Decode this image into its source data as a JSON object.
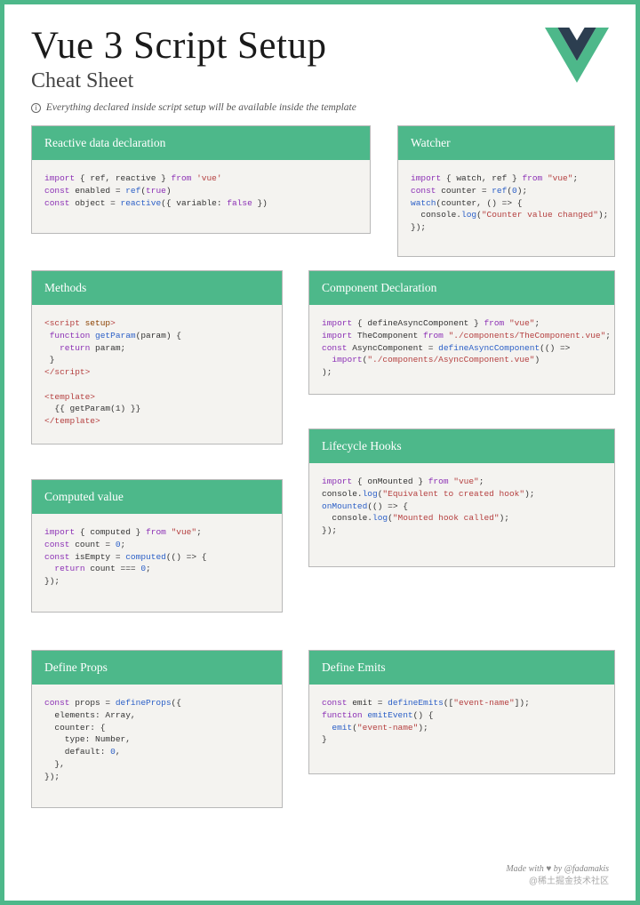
{
  "header": {
    "title": "Vue 3 Script Setup",
    "subtitle": "Cheat Sheet"
  },
  "note": {
    "icon": "i",
    "text": "Everything declared inside script setup will be available inside the template"
  },
  "cards": {
    "reactive": {
      "title": "Reactive data declaration",
      "code": [
        {
          "t": "kw",
          "v": "import"
        },
        {
          "t": "",
          "v": " { ref, reactive } "
        },
        {
          "t": "kw",
          "v": "from"
        },
        {
          "t": "",
          "v": " "
        },
        {
          "t": "str",
          "v": "'vue'"
        },
        {
          "t": "br"
        },
        {
          "t": "kw",
          "v": "const"
        },
        {
          "t": "",
          "v": " enabled = "
        },
        {
          "t": "fn",
          "v": "ref"
        },
        {
          "t": "",
          "v": "("
        },
        {
          "t": "bool",
          "v": "true"
        },
        {
          "t": "",
          "v": ")"
        },
        {
          "t": "br"
        },
        {
          "t": "kw",
          "v": "const"
        },
        {
          "t": "",
          "v": " object = "
        },
        {
          "t": "fn",
          "v": "reactive"
        },
        {
          "t": "",
          "v": "({ variable: "
        },
        {
          "t": "bool",
          "v": "false"
        },
        {
          "t": "",
          "v": " })"
        }
      ]
    },
    "watcher": {
      "title": "Watcher",
      "code": [
        {
          "t": "kw",
          "v": "import"
        },
        {
          "t": "",
          "v": " { watch, ref } "
        },
        {
          "t": "kw",
          "v": "from"
        },
        {
          "t": "",
          "v": " "
        },
        {
          "t": "str",
          "v": "\"vue\""
        },
        {
          "t": "",
          "v": ";"
        },
        {
          "t": "br"
        },
        {
          "t": "kw",
          "v": "const"
        },
        {
          "t": "",
          "v": " counter = "
        },
        {
          "t": "fn",
          "v": "ref"
        },
        {
          "t": "",
          "v": "("
        },
        {
          "t": "num",
          "v": "0"
        },
        {
          "t": "",
          "v": ");"
        },
        {
          "t": "br"
        },
        {
          "t": "fn",
          "v": "watch"
        },
        {
          "t": "",
          "v": "(counter, () => {"
        },
        {
          "t": "br"
        },
        {
          "t": "",
          "v": "  console."
        },
        {
          "t": "fn",
          "v": "log"
        },
        {
          "t": "",
          "v": "("
        },
        {
          "t": "str",
          "v": "\"Counter value changed\""
        },
        {
          "t": "",
          "v": ");"
        },
        {
          "t": "br"
        },
        {
          "t": "",
          "v": "});"
        }
      ]
    },
    "methods": {
      "title": "Methods",
      "code": [
        {
          "t": "tag",
          "v": "<script "
        },
        {
          "t": "attr",
          "v": "setup"
        },
        {
          "t": "tag",
          "v": ">"
        },
        {
          "t": "br"
        },
        {
          "t": "",
          "v": " "
        },
        {
          "t": "kw",
          "v": "function"
        },
        {
          "t": "",
          "v": " "
        },
        {
          "t": "fn",
          "v": "getParam"
        },
        {
          "t": "",
          "v": "(param) {"
        },
        {
          "t": "br"
        },
        {
          "t": "",
          "v": "   "
        },
        {
          "t": "kw",
          "v": "return"
        },
        {
          "t": "",
          "v": " param;"
        },
        {
          "t": "br"
        },
        {
          "t": "",
          "v": " }"
        },
        {
          "t": "br"
        },
        {
          "t": "tag",
          "v": "</script>"
        },
        {
          "t": "br"
        },
        {
          "t": "br"
        },
        {
          "t": "tag",
          "v": "<template>"
        },
        {
          "t": "br"
        },
        {
          "t": "",
          "v": "  {{ getParam(1) }}"
        },
        {
          "t": "br"
        },
        {
          "t": "tag",
          "v": "</template>"
        }
      ]
    },
    "component": {
      "title": "Component Declaration",
      "code": [
        {
          "t": "kw",
          "v": "import"
        },
        {
          "t": "",
          "v": " { defineAsyncComponent } "
        },
        {
          "t": "kw",
          "v": "from"
        },
        {
          "t": "",
          "v": " "
        },
        {
          "t": "str",
          "v": "\"vue\""
        },
        {
          "t": "",
          "v": ";"
        },
        {
          "t": "br"
        },
        {
          "t": "kw",
          "v": "import"
        },
        {
          "t": "",
          "v": " TheComponent "
        },
        {
          "t": "kw",
          "v": "from"
        },
        {
          "t": "",
          "v": " "
        },
        {
          "t": "str",
          "v": "\"./components/TheComponent.vue\""
        },
        {
          "t": "",
          "v": ";"
        },
        {
          "t": "br"
        },
        {
          "t": "kw",
          "v": "const"
        },
        {
          "t": "",
          "v": " AsyncComponent = "
        },
        {
          "t": "fn",
          "v": "defineAsyncComponent"
        },
        {
          "t": "",
          "v": "(() =>"
        },
        {
          "t": "br"
        },
        {
          "t": "",
          "v": "  "
        },
        {
          "t": "kw",
          "v": "import"
        },
        {
          "t": "",
          "v": "("
        },
        {
          "t": "str",
          "v": "\"./components/AsyncComponent.vue\""
        },
        {
          "t": "",
          "v": ")"
        },
        {
          "t": "br"
        },
        {
          "t": "",
          "v": ");"
        }
      ]
    },
    "lifecycle": {
      "title": "Lifecycle Hooks",
      "code": [
        {
          "t": "kw",
          "v": "import"
        },
        {
          "t": "",
          "v": " { onMounted } "
        },
        {
          "t": "kw",
          "v": "from"
        },
        {
          "t": "",
          "v": " "
        },
        {
          "t": "str",
          "v": "\"vue\""
        },
        {
          "t": "",
          "v": ";"
        },
        {
          "t": "br"
        },
        {
          "t": "",
          "v": "console."
        },
        {
          "t": "fn",
          "v": "log"
        },
        {
          "t": "",
          "v": "("
        },
        {
          "t": "str",
          "v": "\"Equivalent to created hook\""
        },
        {
          "t": "",
          "v": ");"
        },
        {
          "t": "br"
        },
        {
          "t": "fn",
          "v": "onMounted"
        },
        {
          "t": "",
          "v": "(() => {"
        },
        {
          "t": "br"
        },
        {
          "t": "",
          "v": "  console."
        },
        {
          "t": "fn",
          "v": "log"
        },
        {
          "t": "",
          "v": "("
        },
        {
          "t": "str",
          "v": "\"Mounted hook called\""
        },
        {
          "t": "",
          "v": ");"
        },
        {
          "t": "br"
        },
        {
          "t": "",
          "v": "});"
        }
      ]
    },
    "computed": {
      "title": "Computed value",
      "code": [
        {
          "t": "kw",
          "v": "import"
        },
        {
          "t": "",
          "v": " { computed } "
        },
        {
          "t": "kw",
          "v": "from"
        },
        {
          "t": "",
          "v": " "
        },
        {
          "t": "str",
          "v": "\"vue\""
        },
        {
          "t": "",
          "v": ";"
        },
        {
          "t": "br"
        },
        {
          "t": "kw",
          "v": "const"
        },
        {
          "t": "",
          "v": " count = "
        },
        {
          "t": "num",
          "v": "0"
        },
        {
          "t": "",
          "v": ";"
        },
        {
          "t": "br"
        },
        {
          "t": "kw",
          "v": "const"
        },
        {
          "t": "",
          "v": " isEmpty = "
        },
        {
          "t": "fn",
          "v": "computed"
        },
        {
          "t": "",
          "v": "(() => {"
        },
        {
          "t": "br"
        },
        {
          "t": "",
          "v": "  "
        },
        {
          "t": "kw",
          "v": "return"
        },
        {
          "t": "",
          "v": " count === "
        },
        {
          "t": "num",
          "v": "0"
        },
        {
          "t": "",
          "v": ";"
        },
        {
          "t": "br"
        },
        {
          "t": "",
          "v": "});"
        }
      ]
    },
    "props": {
      "title": "Define Props",
      "code": [
        {
          "t": "kw",
          "v": "const"
        },
        {
          "t": "",
          "v": " props = "
        },
        {
          "t": "fn",
          "v": "defineProps"
        },
        {
          "t": "",
          "v": "({"
        },
        {
          "t": "br"
        },
        {
          "t": "",
          "v": "  elements: Array,"
        },
        {
          "t": "br"
        },
        {
          "t": "",
          "v": "  counter: {"
        },
        {
          "t": "br"
        },
        {
          "t": "",
          "v": "    type: Number,"
        },
        {
          "t": "br"
        },
        {
          "t": "",
          "v": "    default: "
        },
        {
          "t": "num",
          "v": "0"
        },
        {
          "t": "",
          "v": ","
        },
        {
          "t": "br"
        },
        {
          "t": "",
          "v": "  },"
        },
        {
          "t": "br"
        },
        {
          "t": "",
          "v": "});"
        }
      ]
    },
    "emits": {
      "title": "Define Emits",
      "code": [
        {
          "t": "kw",
          "v": "const"
        },
        {
          "t": "",
          "v": " emit = "
        },
        {
          "t": "fn",
          "v": "defineEmits"
        },
        {
          "t": "",
          "v": "(["
        },
        {
          "t": "str",
          "v": "\"event-name\""
        },
        {
          "t": "",
          "v": "]);"
        },
        {
          "t": "br"
        },
        {
          "t": "kw",
          "v": "function"
        },
        {
          "t": "",
          "v": " "
        },
        {
          "t": "fn",
          "v": "emitEvent"
        },
        {
          "t": "",
          "v": "() {"
        },
        {
          "t": "br"
        },
        {
          "t": "",
          "v": "  "
        },
        {
          "t": "fn",
          "v": "emit"
        },
        {
          "t": "",
          "v": "("
        },
        {
          "t": "str",
          "v": "\"event-name\""
        },
        {
          "t": "",
          "v": ");"
        },
        {
          "t": "br"
        },
        {
          "t": "",
          "v": "}"
        }
      ]
    }
  },
  "footer": {
    "line1_pre": "Made with ",
    "heart": "♥",
    "line1_post": " by @fadamakis",
    "line2": "@稀土掘金技术社区"
  }
}
